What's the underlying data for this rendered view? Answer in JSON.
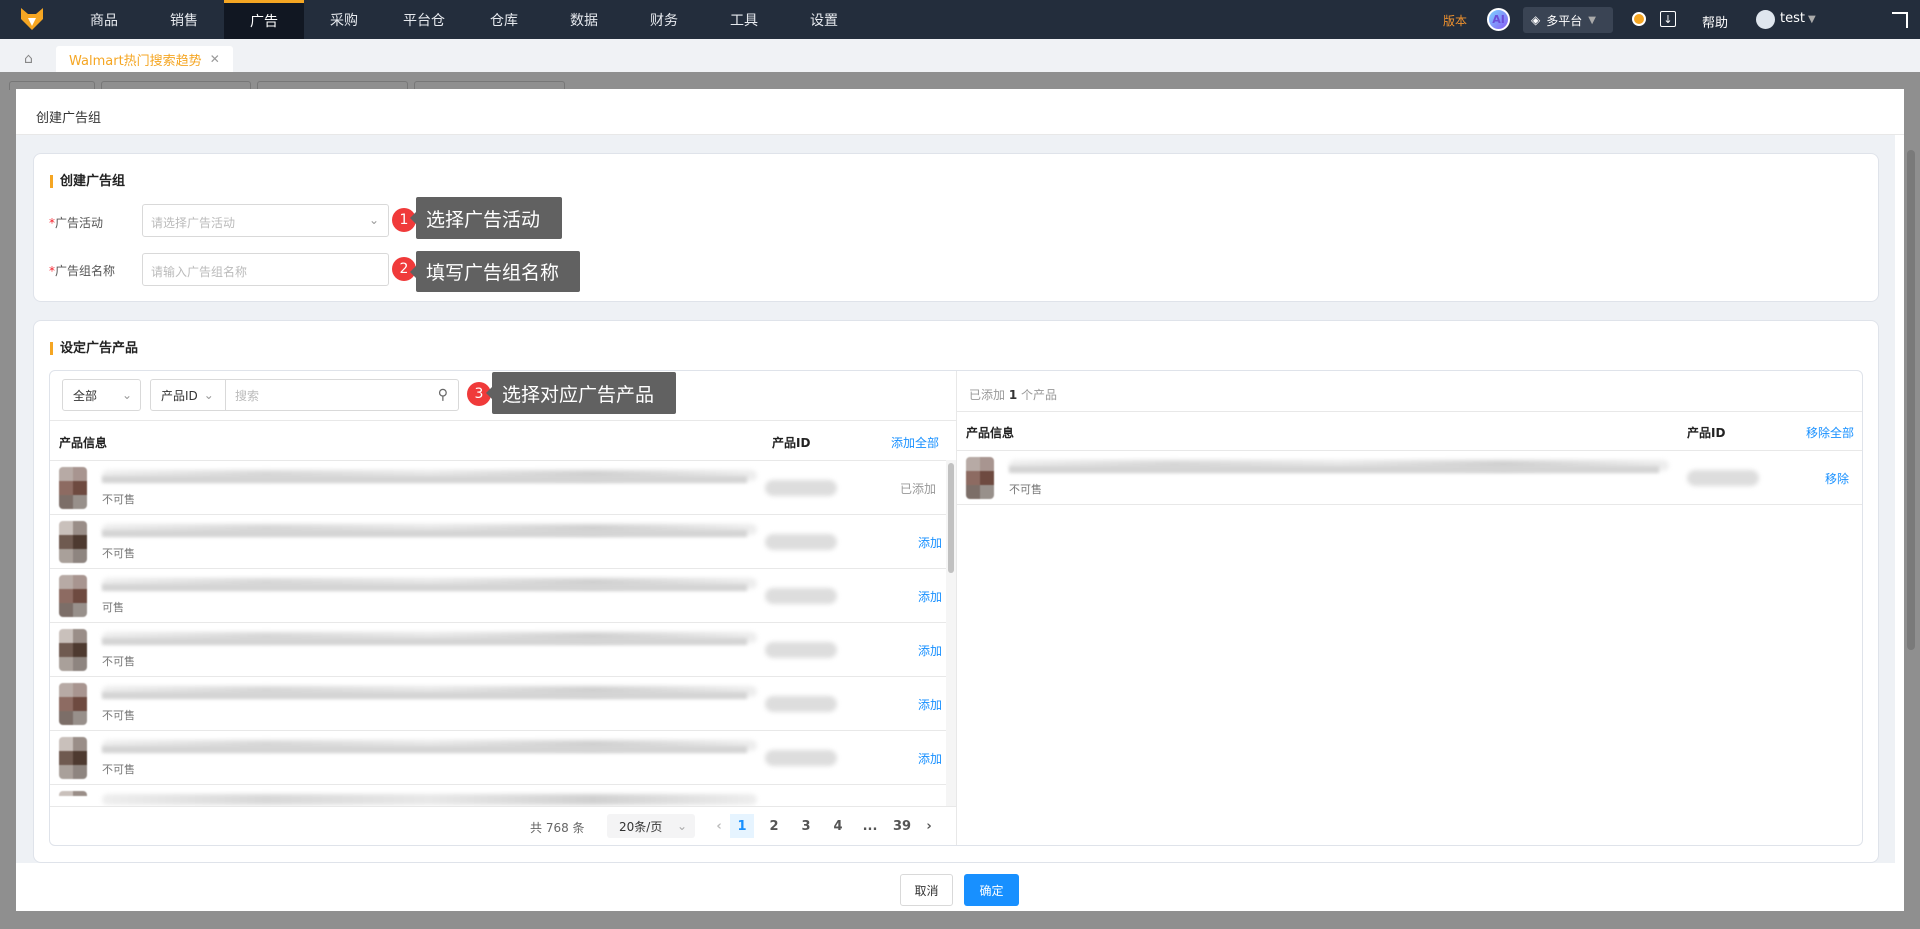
{
  "nav": {
    "items": [
      "商品",
      "销售",
      "广告",
      "采购",
      "平台仓",
      "仓库",
      "数据",
      "财务",
      "工具",
      "设置"
    ],
    "active_index": 2,
    "version": "版本",
    "ai": "AI",
    "platform": "多平台",
    "help": "帮助",
    "user": "test"
  },
  "tabs": [
    {
      "label": "Walmart热门搜索趋势"
    }
  ],
  "modal": {
    "title": "创建广告组",
    "section1": {
      "title": "创建广告组",
      "campaign_label": "广告活动",
      "campaign_placeholder": "请选择广告活动",
      "name_label": "广告组名称",
      "name_placeholder": "请输入广告组名称",
      "required_mark": "*"
    },
    "tips": [
      {
        "num": "1",
        "text": "选择广告活动"
      },
      {
        "num": "2",
        "text": "填写广告组名称"
      },
      {
        "num": "3",
        "text": "选择对应广告产品"
      }
    ],
    "section2": {
      "title": "设定广告产品",
      "left": {
        "filter": "全部",
        "search_type": "产品ID",
        "search_placeholder": "搜索",
        "col_info": "产品信息",
        "col_id": "产品ID",
        "add_all": "添加全部",
        "rows": [
          {
            "status": "不可售",
            "action": "已添加"
          },
          {
            "status": "不可售",
            "action": "添加"
          },
          {
            "status": "可售",
            "action": "添加"
          },
          {
            "status": "不可售",
            "action": "添加"
          },
          {
            "status": "不可售",
            "action": "添加"
          },
          {
            "status": "不可售",
            "action": "添加"
          }
        ],
        "pagination": {
          "total": "共 768 条",
          "page_size": "20条/页",
          "pages": [
            "1",
            "2",
            "3",
            "4",
            "...",
            "39"
          ],
          "current": "1"
        }
      },
      "right": {
        "added_prefix": "已添加",
        "added_count": "1",
        "added_suffix": "个产品",
        "col_info": "产品信息",
        "col_id": "产品ID",
        "remove_all": "移除全部",
        "rows": [
          {
            "status": "不可售",
            "action": "移除"
          }
        ]
      }
    }
  },
  "footer": {
    "cancel": "取消",
    "confirm": "确定"
  },
  "colors": {
    "accent": "#f5a623",
    "primary": "#1890ff",
    "badge": "#f03a3a"
  }
}
